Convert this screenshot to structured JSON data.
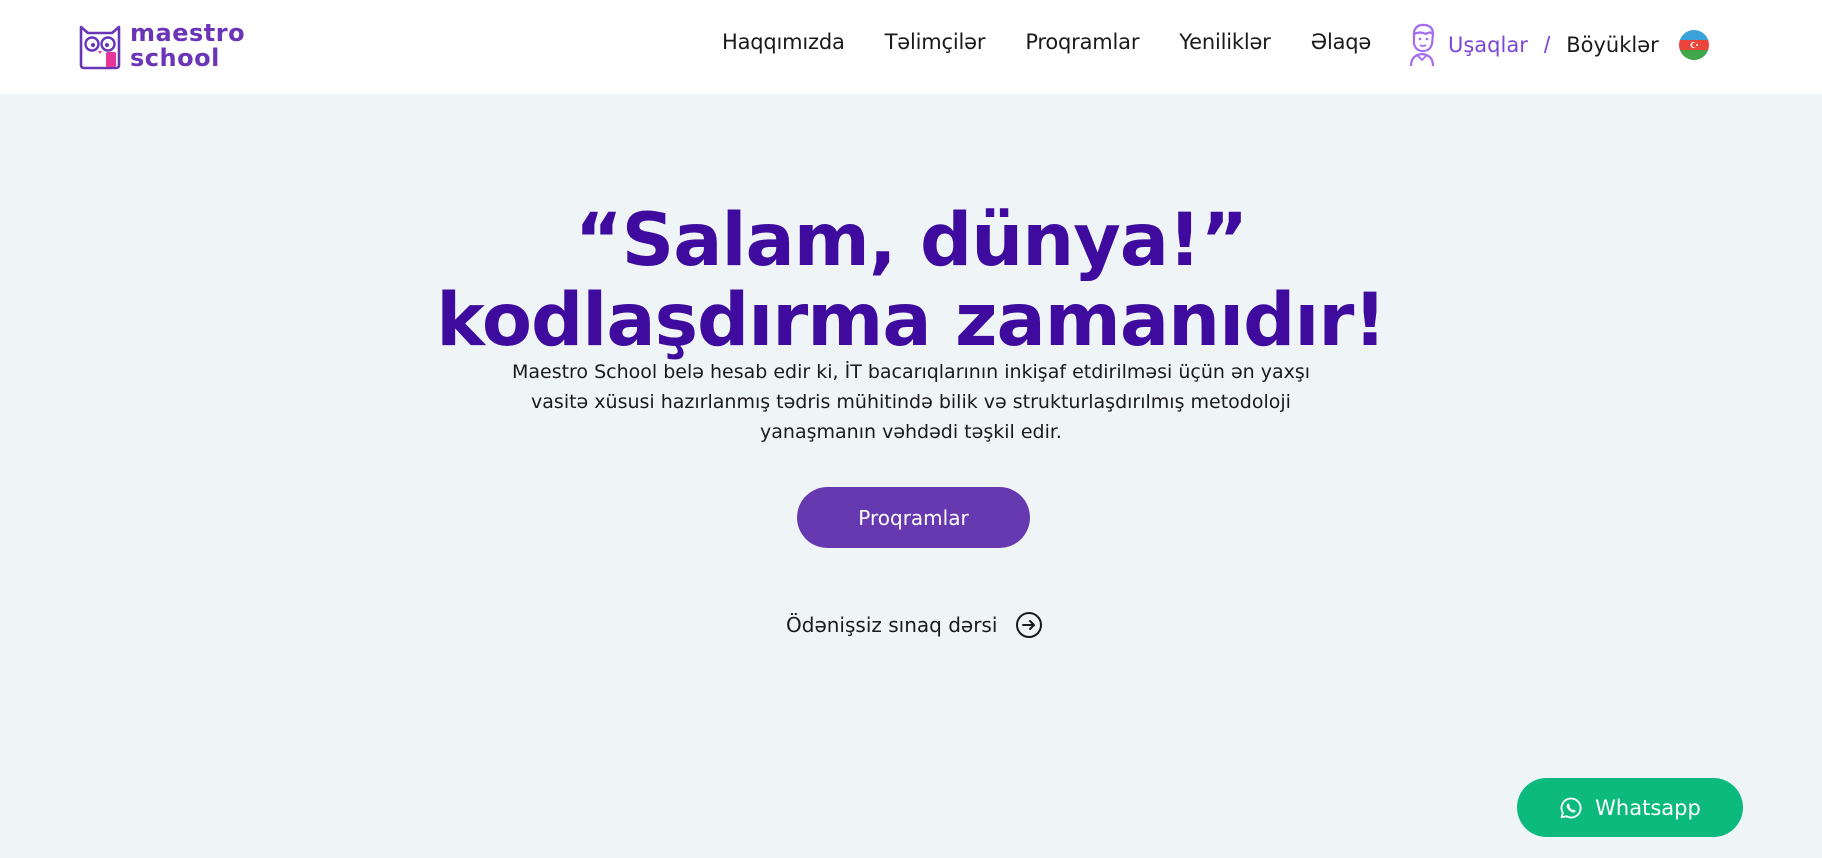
{
  "brand": {
    "line1": "maestro",
    "line2": "school",
    "color": "#6a35b6",
    "accent": "#e8359a"
  },
  "nav": {
    "items": [
      {
        "label": "Haqqımızda"
      },
      {
        "label": "Təlimçilər"
      },
      {
        "label": "Proqramlar"
      },
      {
        "label": "Yeniliklər"
      },
      {
        "label": "Əlaqə"
      }
    ]
  },
  "audience": {
    "kids": "Uşaqlar",
    "separator": "/",
    "adults": "Böyüklər",
    "active": "kids"
  },
  "language": {
    "flag": "azerbaijan-flag"
  },
  "hero": {
    "title_line1": "“Salam, dünya!”",
    "title_line2": "kodlaşdırma zamanıdır!",
    "subtitle": "Maestro School belə hesab edir ki, İT bacarıqlarının inkişaf etdirilməsi üçün ən yaxşı vasitə xüsusi hazırlanmış tədris mühitində bilik və strukturlaşdırılmış metodoloji yanaşmanın vəhdədi təşkil edir.",
    "cta_label": "Proqramlar",
    "trial_label": "Ödənişsiz sınaq dərsi"
  },
  "whatsapp": {
    "label": "Whatsapp"
  },
  "colors": {
    "background": "#eff4f6",
    "title": "#3e0b9e",
    "cta": "#6739b0",
    "whatsapp": "#0dba7d",
    "audience_active": "#7c45d6"
  }
}
